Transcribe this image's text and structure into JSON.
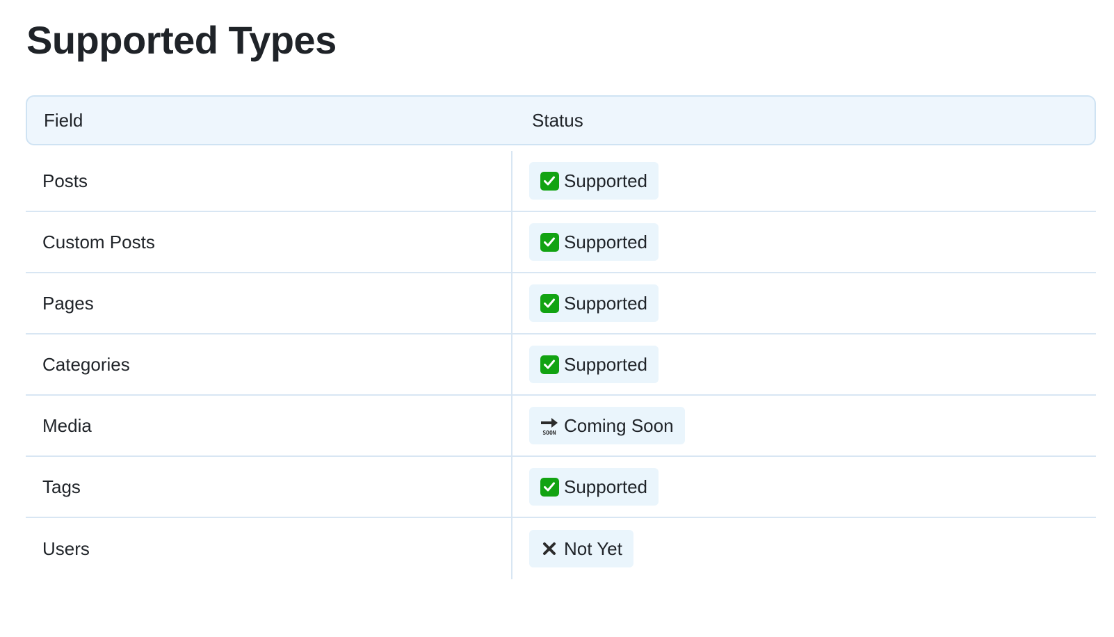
{
  "page": {
    "title": "Supported Types"
  },
  "table": {
    "headers": {
      "field": "Field",
      "status": "Status"
    },
    "rows": [
      {
        "field": "Posts",
        "status": "Supported",
        "icon": "check-mark-icon"
      },
      {
        "field": "Custom Posts",
        "status": "Supported",
        "icon": "check-mark-icon"
      },
      {
        "field": "Pages",
        "status": "Supported",
        "icon": "check-mark-icon"
      },
      {
        "field": "Categories",
        "status": "Supported",
        "icon": "check-mark-icon"
      },
      {
        "field": "Media",
        "status": "Coming Soon",
        "icon": "soon-arrow-icon"
      },
      {
        "field": "Tags",
        "status": "Supported",
        "icon": "check-mark-icon"
      },
      {
        "field": "Users",
        "status": "Not Yet",
        "icon": "cross-mark-icon"
      }
    ]
  },
  "icons": {
    "soon_label": "SOON"
  },
  "colors": {
    "header_bg": "#eef6fd",
    "badge_bg": "#eaf5fc",
    "border": "#d8e6f3",
    "check_green": "#12a312"
  }
}
